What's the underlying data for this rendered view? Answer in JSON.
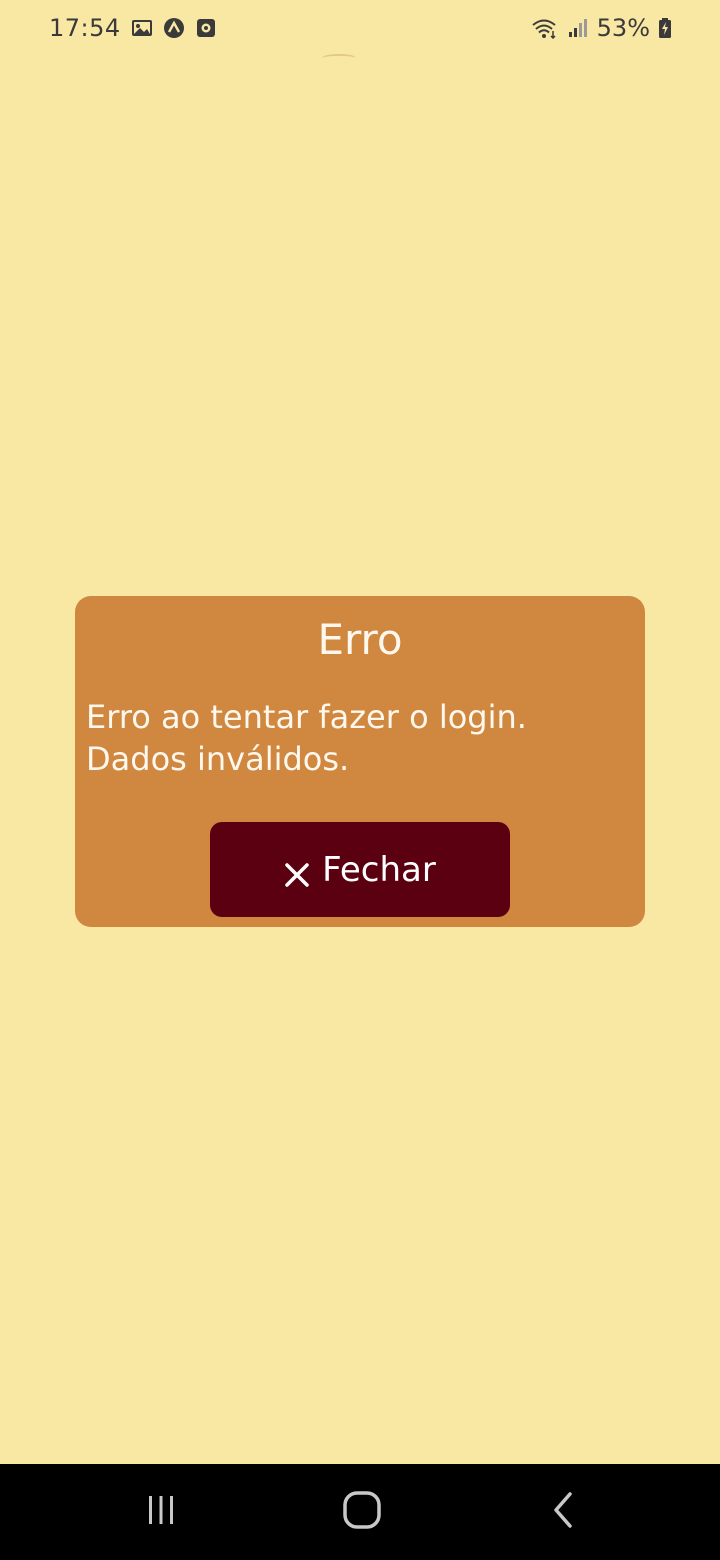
{
  "status_bar": {
    "time": "17:54",
    "battery_percent": "53%",
    "icons": [
      "gallery-icon",
      "app-notification-icon",
      "media-icon",
      "wifi-icon",
      "signal-icon",
      "battery-charging-icon"
    ]
  },
  "dialog": {
    "title": "Erro",
    "message": "Erro ao tentar fazer o login. Dados inválidos.",
    "close_button_label": "Fechar",
    "close_button_icon": "close-icon"
  },
  "nav_bar": {
    "buttons": [
      "recent-apps-icon",
      "home-icon",
      "back-icon"
    ]
  },
  "colors": {
    "background": "#f9e8a3",
    "dialog": "#d0873f",
    "button": "#5a0010",
    "text_light": "#fff8ee",
    "navbar": "#000000"
  }
}
